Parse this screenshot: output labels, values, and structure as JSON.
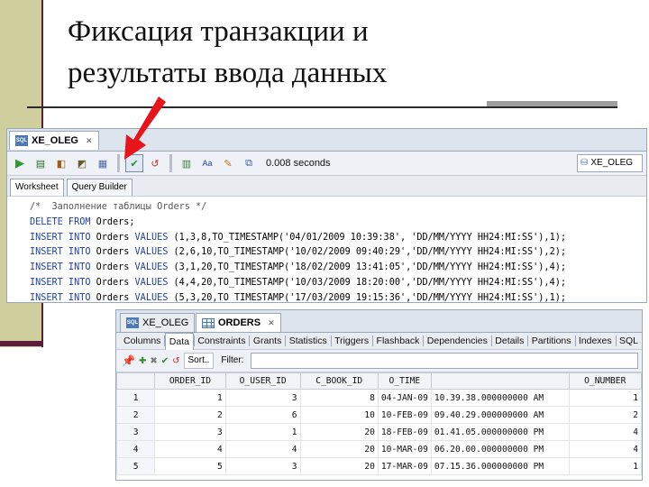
{
  "slide": {
    "title_line1": "Фиксация транзакции и",
    "title_line2": "результаты ввода данных"
  },
  "worksheet": {
    "connection_tab": "XE_OLEG",
    "sql_badge": "SQL",
    "elapsed": "0.008 seconds",
    "connection_select": "XE_OLEG",
    "subtabs": [
      "Worksheet",
      "Query Builder"
    ],
    "code_lines": [
      {
        "parts": [
          {
            "t": "/*  Заполнение таблицы Orders */",
            "c": "cmt"
          }
        ]
      },
      {
        "parts": [
          {
            "t": "DELETE FROM",
            "c": "kw"
          },
          {
            "t": " Orders;",
            "c": ""
          }
        ]
      },
      {
        "parts": [
          {
            "t": "INSERT INTO",
            "c": "kw"
          },
          {
            "t": " Orders ",
            "c": ""
          },
          {
            "t": "VALUES",
            "c": "kw"
          },
          {
            "t": " (1,3,8,TO_TIMESTAMP('04/01/2009 10:39:38', 'DD/MM/YYYY HH24:MI:SS'),1);",
            "c": ""
          }
        ]
      },
      {
        "parts": [
          {
            "t": "INSERT INTO",
            "c": "kw"
          },
          {
            "t": " Orders ",
            "c": ""
          },
          {
            "t": "VALUES",
            "c": "kw"
          },
          {
            "t": " (2,6,10,TO_TIMESTAMP('10/02/2009 09:40:29','DD/MM/YYYY HH24:MI:SS'),2);",
            "c": ""
          }
        ]
      },
      {
        "parts": [
          {
            "t": "INSERT INTO",
            "c": "kw"
          },
          {
            "t": " Orders ",
            "c": ""
          },
          {
            "t": "VALUES",
            "c": "kw"
          },
          {
            "t": " (3,1,20,TO_TIMESTAMP('18/02/2009 13:41:05','DD/MM/YYYY HH24:MI:SS'),4);",
            "c": ""
          }
        ]
      },
      {
        "parts": [
          {
            "t": "INSERT INTO",
            "c": "kw"
          },
          {
            "t": " Orders ",
            "c": ""
          },
          {
            "t": "VALUES",
            "c": "kw"
          },
          {
            "t": " (4,4,20,TO_TIMESTAMP('10/03/2009 18:20:00','DD/MM/YYYY HH24:MI:SS'),4);",
            "c": ""
          }
        ]
      },
      {
        "parts": [
          {
            "t": "INSERT INTO",
            "c": "kw"
          },
          {
            "t": " Orders ",
            "c": ""
          },
          {
            "t": "VALUES",
            "c": "kw"
          },
          {
            "t": " (5,3,20,TO_TIMESTAMP('17/03/2009 19:15:36','DD/MM/YYYY HH24:MI:SS'),1);",
            "c": ""
          }
        ]
      }
    ]
  },
  "orders_view": {
    "tabs": [
      "XE_OLEG",
      "ORDERS"
    ],
    "object_tabs": [
      "Columns",
      "Data",
      "Constraints",
      "Grants",
      "Statistics",
      "Triggers",
      "Flashback",
      "Dependencies",
      "Details",
      "Partitions",
      "Indexes",
      "SQL"
    ],
    "active_object_tab": "Data",
    "sort_label": "Sort..",
    "filter_label": "Filter:",
    "columns": [
      "",
      "ORDER_ID",
      "O_USER_ID",
      "C_BOOK_ID",
      "O_TIME",
      "",
      "O_NUMBER"
    ],
    "rows": [
      [
        "1",
        "1",
        "3",
        "8",
        "04-JAN-09",
        "10.39.38.000000000 AM",
        "1"
      ],
      [
        "2",
        "2",
        "6",
        "10",
        "10-FEB-09",
        "09.40.29.000000000 AM",
        "2"
      ],
      [
        "3",
        "3",
        "1",
        "20",
        "18-FEB-09",
        "01.41.05.000000000 PM",
        "4"
      ],
      [
        "4",
        "4",
        "4",
        "20",
        "10-MAR-09",
        "06.20.00.000000000 PM",
        "4"
      ],
      [
        "5",
        "5",
        "3",
        "20",
        "17-MAR-09",
        "07.15.36.000000000 PM",
        "1"
      ]
    ]
  },
  "colors": {
    "arrow": "#e8141b",
    "accent_bar": "#cfcf9e",
    "accent_line": "#5a1e3a"
  }
}
